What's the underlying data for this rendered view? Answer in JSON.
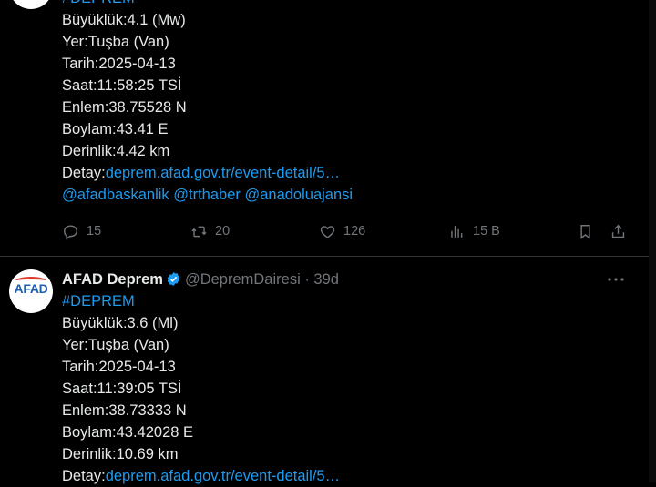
{
  "tweet1": {
    "lines": {
      "hashtag": "#DEPREM",
      "magnitude": "Büyüklük:4.1 (Mw)",
      "place": "Yer:Tuşba (Van)",
      "date": "Tarih:2025-04-13",
      "time": "Saat:11:58:25 TSİ",
      "lat": "Enlem:38.75528 N",
      "lon": "Boylam:43.41 E",
      "depth": "Derinlik:4.42 km",
      "detail_label": "Detay:",
      "detail_link": "deprem.afad.gov.tr/event-detail/5…",
      "mentions": [
        "@afadbaskanlik",
        "@trthaber",
        "@anadoluajansi"
      ]
    },
    "actions": {
      "replies": "15",
      "reposts": "20",
      "likes": "126",
      "views": "15 B"
    }
  },
  "tweet2": {
    "author": {
      "name": "AFAD Deprem",
      "handle": "@DepremDairesi",
      "separator": "·",
      "age": "39d",
      "avatar_text": "AFAD"
    },
    "lines": {
      "hashtag": "#DEPREM",
      "magnitude": "Büyüklük:3.6 (Ml)",
      "place": "Yer:Tuşba (Van)",
      "date": "Tarih:2025-04-13",
      "time": "Saat:11:39:05 TSİ",
      "lat": "Enlem:38.73333 N",
      "lon": "Boylam:43.42028 E",
      "depth": "Derinlik:10.69 km",
      "detail_label": "Detay:",
      "detail_link": "deprem.afad.gov.tr/event-detail/5…"
    }
  },
  "colors": {
    "background": "#000000",
    "text": "#e7e9ea",
    "muted": "#71767b",
    "link": "#1d9bf0",
    "verified": "#1d9bf0",
    "avatar_brand": "#1d5fae"
  },
  "icons": [
    "reply-icon",
    "repost-icon",
    "like-icon",
    "views-icon",
    "bookmark-icon",
    "share-icon",
    "more-icon",
    "verified-badge-icon"
  ]
}
